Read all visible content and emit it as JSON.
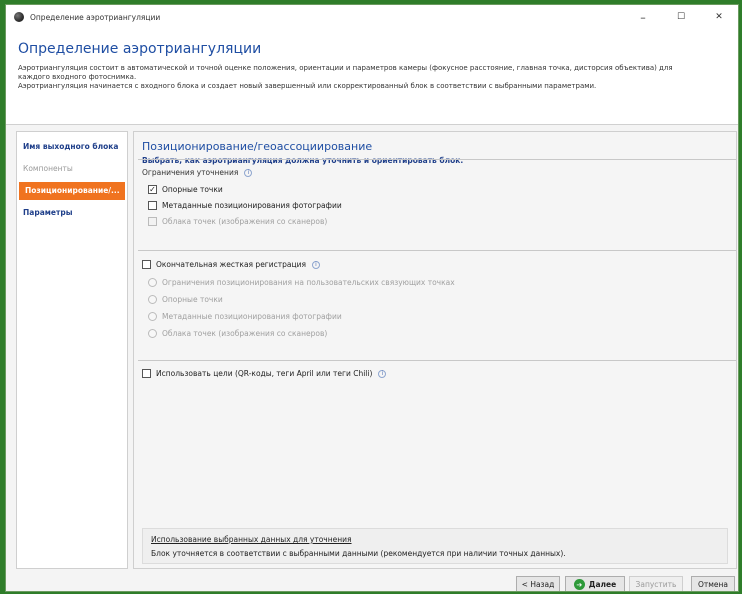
{
  "window": {
    "title": "Определение аэротриангуляции",
    "minimize": "–",
    "maximize": "☐",
    "close": "✕"
  },
  "header": {
    "title": "Определение аэротриангуляции",
    "desc_line1": "Аэротриангуляция состоит в автоматической и точной оценке положения, ориентации и параметров камеры (фокусное расстояние, главная точка, дисторсия объектива) для",
    "desc_line2": "каждого входного фотоснимка.",
    "desc_line3": "Аэротриангуляция начинается с входного блока и создает новый завершенный или скорректированный блок в соответствии с выбранными параметрами."
  },
  "sidebar": {
    "items": [
      {
        "label": "Имя выходного блока",
        "state": "link"
      },
      {
        "label": "Компоненты",
        "state": "disabled"
      },
      {
        "label": "Позиционирование/...",
        "state": "active"
      },
      {
        "label": "Параметры",
        "state": "link"
      }
    ]
  },
  "content": {
    "title": "Позиционирование/геоассоциирование",
    "subtitle": "Выбрать, как аэротриангуляция должна уточнить и ориентировать блок.",
    "constraints": {
      "title": "Ограничения уточнения",
      "options": [
        {
          "label": "Опорные точки",
          "checked": true,
          "enabled": true
        },
        {
          "label": "Метаданные позиционирования фотографии",
          "checked": false,
          "enabled": true
        },
        {
          "label": "Облака точек (изображения со сканеров)",
          "checked": false,
          "enabled": false
        }
      ]
    },
    "rigid": {
      "label": "Окончательная жесткая регистрация",
      "checked": false,
      "options": [
        {
          "label": "Ограничения позиционирования на пользовательских связующих точках"
        },
        {
          "label": "Опорные точки"
        },
        {
          "label": "Метаданные позиционирования фотографии"
        },
        {
          "label": "Облака точек (изображения со сканеров)"
        }
      ]
    },
    "targets": {
      "label": "Использовать цели (QR-коды, теги April или теги Chili)",
      "checked": false
    },
    "bottom": {
      "link": "Использование выбранных данных для уточнения",
      "text": "Блок уточняется в соответствии с выбранными данными (рекомендуется при наличии точных данных)."
    },
    "info_glyph": "i",
    "check_glyph": "✓"
  },
  "footer": {
    "back": "< Назад",
    "next": "Далее",
    "next_glyph": "➔",
    "run": "Запустить",
    "cancel": "Отмена"
  }
}
